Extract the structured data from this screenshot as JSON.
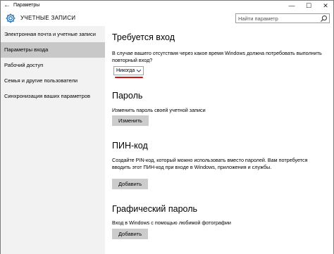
{
  "window": {
    "title": "Параметры",
    "back_glyph": "←",
    "minimize_glyph": "—",
    "maximize_glyph": "☐",
    "close_glyph": "✕"
  },
  "header": {
    "title": "УЧЕТНЫЕ ЗАПИСИ",
    "icon": "gear-icon",
    "search": {
      "placeholder": "Найти параметр",
      "value": "",
      "icon": "search-icon"
    }
  },
  "sidebar": {
    "items": [
      {
        "label": "Электронная почта и учетные записи",
        "active": false
      },
      {
        "label": "Параметры входа",
        "active": true
      },
      {
        "label": "Рабочий доступ",
        "active": false
      },
      {
        "label": "Семья и другие пользователи",
        "active": false
      },
      {
        "label": "Синхронизация ваших параметров",
        "active": false
      }
    ]
  },
  "main": {
    "require_signin": {
      "title": "Требуется вход",
      "description": "В случае вашего отсутствия через какое время Windows должна потребовать выполнить повторный вход?",
      "dropdown_value": "Никогда"
    },
    "password": {
      "title": "Пароль",
      "description": "Изменить пароль своей учетной записи",
      "button": "Изменить"
    },
    "pin": {
      "title": "ПИН-код",
      "description": "Создайте PIN-код, который можно использовать вместо паролей. Вам потребуется вводить этот ПИН-код при входе в Windows, приложения и службы.",
      "button": "Добавить"
    },
    "picture_password": {
      "title": "Графический пароль",
      "description": "Вход в Windows с помощью любимой фотографии",
      "button": "Добавить"
    }
  },
  "colors": {
    "sidebar_bg": "#f2f2f2",
    "active_item_bg": "#c8c8c8",
    "button_bg": "#cccccc",
    "annotation_red": "#d01010"
  }
}
